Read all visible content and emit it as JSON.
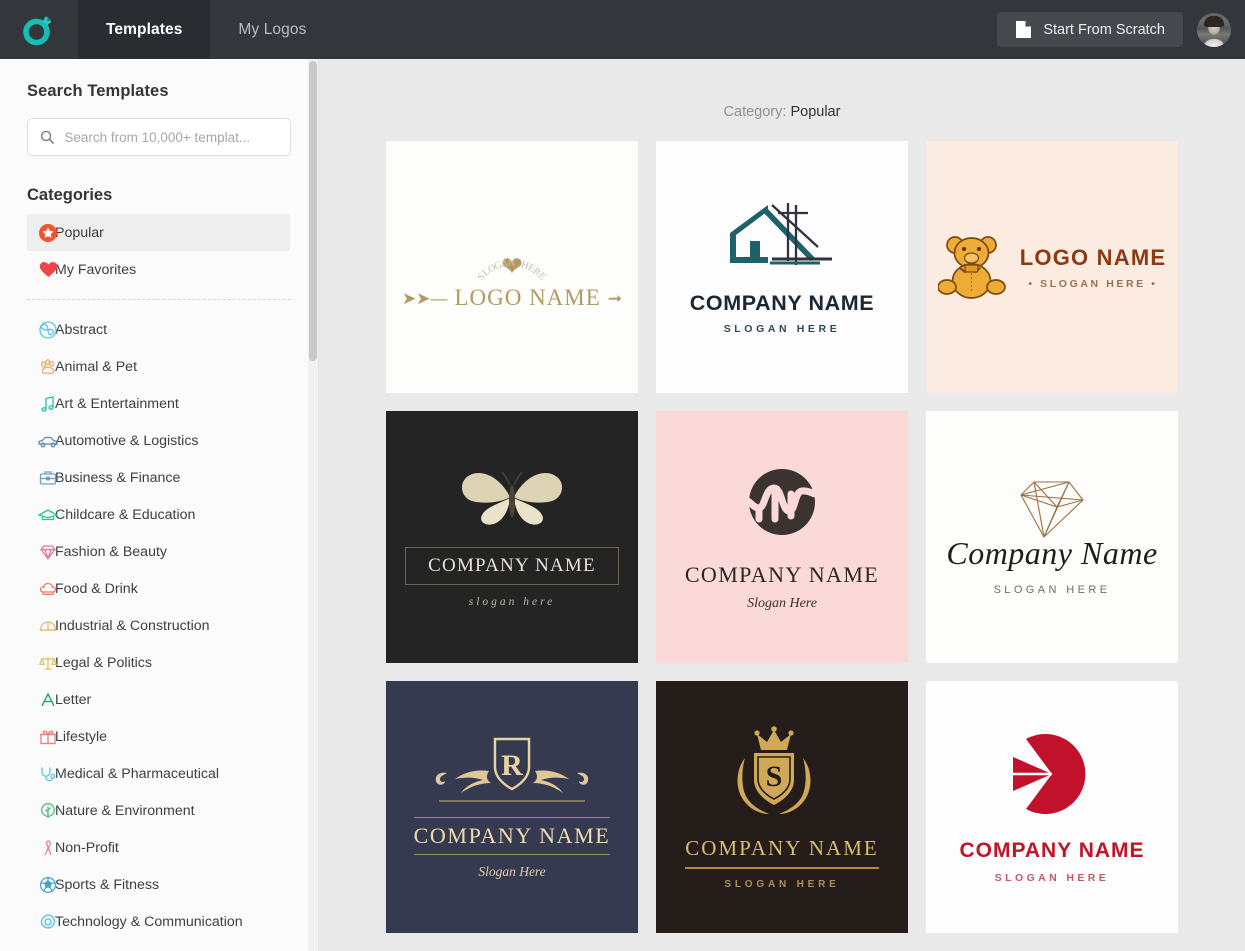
{
  "header": {
    "brand_icon": "designevo-logo-icon",
    "brand_color": "#1bbdb0",
    "tabs": [
      {
        "label": "Templates",
        "active": true
      },
      {
        "label": "My Logos",
        "active": false
      }
    ],
    "start_from_scratch_label": "Start From Scratch",
    "start_from_scratch_icon": "document-page-icon",
    "avatar_icon": "user-avatar"
  },
  "sidebar": {
    "search_title": "Search Templates",
    "search_placeholder": "Search from 10,000+ templat...",
    "search_value": "",
    "search_icon": "search-icon",
    "categories_title": "Categories",
    "pinned": [
      {
        "label": "Popular",
        "icon": "star-badge-icon",
        "color": "#f2542d",
        "selected": true
      },
      {
        "label": "My Favorites",
        "icon": "heart-icon",
        "color": "#f0464a",
        "selected": false
      }
    ],
    "items": [
      {
        "label": "Abstract",
        "icon": "abstract-pinwheel-icon",
        "color": "#5bc8e0"
      },
      {
        "label": "Animal & Pet",
        "icon": "paw-print-icon",
        "color": "#e3ae6e"
      },
      {
        "label": "Art & Entertainment",
        "icon": "music-note-icon",
        "color": "#24c0a4"
      },
      {
        "label": "Automotive & Logistics",
        "icon": "car-icon",
        "color": "#5d8ab8"
      },
      {
        "label": "Business & Finance",
        "icon": "briefcase-icon",
        "color": "#6f9fc4"
      },
      {
        "label": "Childcare & Education",
        "icon": "graduation-cap-icon",
        "color": "#2fc59c"
      },
      {
        "label": "Fashion & Beauty",
        "icon": "diamond-gem-icon",
        "color": "#e77394"
      },
      {
        "label": "Food & Drink",
        "icon": "chef-hat-icon",
        "color": "#ef7b6d"
      },
      {
        "label": "Industrial & Construction",
        "icon": "hard-hat-icon",
        "color": "#e8b870"
      },
      {
        "label": "Legal & Politics",
        "icon": "scales-balance-icon",
        "color": "#ddc463"
      },
      {
        "label": "Letter",
        "icon": "letter-a-icon",
        "color": "#2e9e7c"
      },
      {
        "label": "Lifestyle",
        "icon": "gift-box-icon",
        "color": "#ee7f81"
      },
      {
        "label": "Medical & Pharmaceutical",
        "icon": "stethoscope-icon",
        "color": "#5fc6e0"
      },
      {
        "label": "Nature & Environment",
        "icon": "tree-circle-icon",
        "color": "#4fbf84"
      },
      {
        "label": "Non-Profit",
        "icon": "awareness-ribbon-icon",
        "color": "#ef8197"
      },
      {
        "label": "Sports & Fitness",
        "icon": "soccer-ball-icon",
        "color": "#3aa5cf"
      },
      {
        "label": "Technology & Communication",
        "icon": "tech-gear-node-icon",
        "color": "#4ec2db"
      }
    ]
  },
  "main": {
    "category_prefix": "Category:",
    "category_value": "Popular",
    "templates": [
      {
        "id": "tpl-slogan-heart-arrow",
        "slogan_arc": "SLOGAN HERE",
        "name": "LOGO NAME",
        "icon": "heart-and-arrow-icon",
        "bg": "#fdfdfb",
        "accent": "#b29a63"
      },
      {
        "id": "tpl-house-architecture",
        "name": "COMPANY NAME",
        "slogan": "SLOGAN HERE",
        "icon": "house-blueprint-icon",
        "bg": "#fdfdfd",
        "accent": "#1e6168"
      },
      {
        "id": "tpl-teddy-bear",
        "name": "LOGO NAME",
        "slogan": "• SLOGAN HERE •",
        "icon": "teddy-bear-icon",
        "bg": "#fcebe0",
        "accent": "#8b3a12"
      },
      {
        "id": "tpl-butterfly-dark",
        "name": "COMPANY NAME",
        "slogan": "slogan here",
        "icon": "butterfly-icon",
        "bg": "#242424",
        "accent": "#d9d1b6"
      },
      {
        "id": "tpl-monogram-m-pink",
        "name": "COMPANY NAME",
        "slogan": "Slogan Here",
        "icon": "monogram-m-circle-icon",
        "bg": "#fcd9d9",
        "accent": "#3a3330"
      },
      {
        "id": "tpl-diamond-script",
        "name": "Company Name",
        "slogan": "SLOGAN HERE",
        "icon": "diamond-outline-icon",
        "bg": "#fdfdfb",
        "accent": "#9b6f43"
      },
      {
        "id": "tpl-shield-r-navy",
        "name": "COMPANY NAME",
        "slogan": "Slogan Here",
        "monogram": "R",
        "icon": "ornate-shield-icon",
        "bg": "#363a50",
        "accent": "#f0dcb4"
      },
      {
        "id": "tpl-crest-s-gold",
        "name": "COMPANY NAME",
        "slogan": "SLOGAN HERE",
        "monogram": "S",
        "icon": "crown-crest-laurel-icon",
        "bg": "#241d19",
        "accent": "#dcbd74"
      },
      {
        "id": "tpl-red-arrow-circle",
        "name": "COMPANY NAME",
        "slogan": "SLOGAN HERE",
        "icon": "red-arrow-circle-icon",
        "bg": "#fdfdfd",
        "accent": "#bf1528"
      }
    ]
  }
}
